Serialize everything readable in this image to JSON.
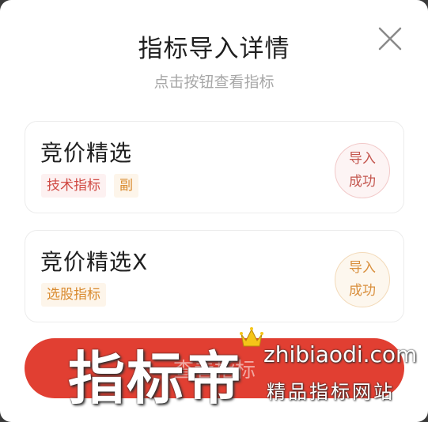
{
  "modal": {
    "title": "指标导入详情",
    "subtitle": "点击按钮查看指标"
  },
  "close_icon": "close-icon",
  "items": [
    {
      "name": "竞价精选",
      "tags": [
        "技术指标",
        "副"
      ],
      "tag_colors": [
        "#d04a44",
        "#d98a2e"
      ],
      "status_line1": "导入",
      "status_line2": "成功",
      "status_color": "#c4574f"
    },
    {
      "name": "竞价精选X",
      "tags": [
        "选股指标"
      ],
      "tag_colors": [
        "#d98a2e"
      ],
      "status_line1": "导入",
      "status_line2": "成功",
      "status_color": "#d98f3d"
    }
  ],
  "action_button": {
    "label": "查看指标",
    "color": "#e13f32"
  },
  "watermark": {
    "brand": "指标帝",
    "domain": "zhibiaodi.com",
    "slogan": "精品指标网站",
    "crown_icon": "crown-icon"
  }
}
